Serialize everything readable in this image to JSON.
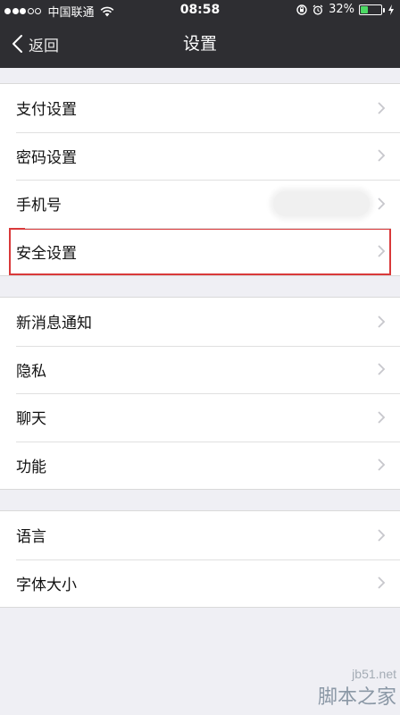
{
  "status_bar": {
    "carrier": "中国联通",
    "time": "08:58",
    "battery_percent": "32%",
    "battery_level": 0.32,
    "signal_bars_filled": 3,
    "signal_bars_total": 5,
    "icons": [
      "wifi-icon",
      "rotation-lock-icon",
      "alarm-icon",
      "charging-icon"
    ]
  },
  "nav": {
    "back_label": "返回",
    "title": "设置",
    "back_icon": "chevron-left-icon"
  },
  "groups": [
    {
      "items": [
        {
          "label": "支付设置"
        },
        {
          "label": "密码设置"
        },
        {
          "label": "手机号",
          "value_hidden": true
        },
        {
          "label": "安全设置",
          "highlighted": true
        }
      ]
    },
    {
      "items": [
        {
          "label": "新消息通知"
        },
        {
          "label": "隐私"
        },
        {
          "label": "聊天"
        },
        {
          "label": "功能"
        }
      ]
    },
    {
      "items": [
        {
          "label": "语言"
        },
        {
          "label": "字体大小"
        }
      ]
    }
  ],
  "watermark": {
    "line1": "jb51.net",
    "line2": "脚本之家"
  },
  "colors": {
    "nav_background": "#2e2e32",
    "page_background": "#efeff4",
    "highlight_border": "#d9393a",
    "battery_fill": "#4cd964"
  }
}
